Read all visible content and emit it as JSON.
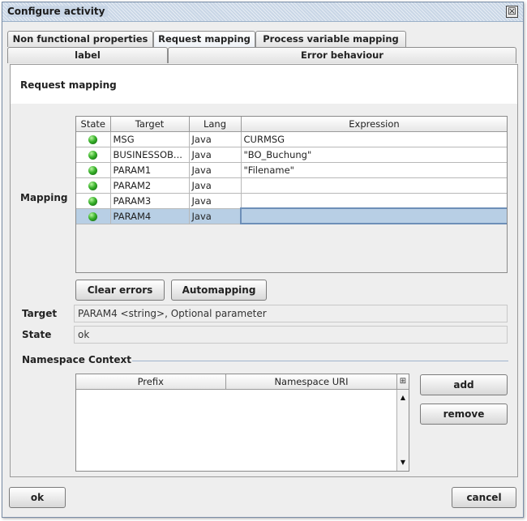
{
  "window": {
    "title": "Configure activity",
    "close_glyph": "☒"
  },
  "tabs": {
    "row1": [
      "Non functional properties",
      "Request mapping",
      "Process variable mapping"
    ],
    "row2": [
      "label",
      "Error behaviour"
    ],
    "selected": "Request mapping"
  },
  "panel": {
    "title": "Request mapping"
  },
  "mapping": {
    "label": "Mapping",
    "columns": [
      "State",
      "Target",
      "Lang",
      "Expression"
    ],
    "rows": [
      {
        "state": "ok",
        "target": "MSG",
        "lang": "Java",
        "expression": "CURMSG"
      },
      {
        "state": "ok",
        "target": "BUSINESSOB...",
        "lang": "Java",
        "expression": "\"BO_Buchung\""
      },
      {
        "state": "ok",
        "target": "PARAM1",
        "lang": "Java",
        "expression": "\"Filename\""
      },
      {
        "state": "ok",
        "target": "PARAM2",
        "lang": "Java",
        "expression": ""
      },
      {
        "state": "ok",
        "target": "PARAM3",
        "lang": "Java",
        "expression": ""
      },
      {
        "state": "ok",
        "target": "PARAM4",
        "lang": "Java",
        "expression": ""
      }
    ],
    "selected_row": 5,
    "state_color": "#2e9e22"
  },
  "buttons": {
    "clear_errors": "Clear errors",
    "automapping": "Automapping",
    "add": "add",
    "remove": "remove",
    "ok": "ok",
    "cancel": "cancel"
  },
  "target": {
    "label": "Target",
    "value": "PARAM4 <string>, Optional parameter"
  },
  "state": {
    "label": "State",
    "value": "ok"
  },
  "namespace": {
    "label": "Namespace Context",
    "columns": [
      "Prefix",
      "Namespace URI"
    ],
    "column_control_icon": "column-chooser-icon"
  }
}
